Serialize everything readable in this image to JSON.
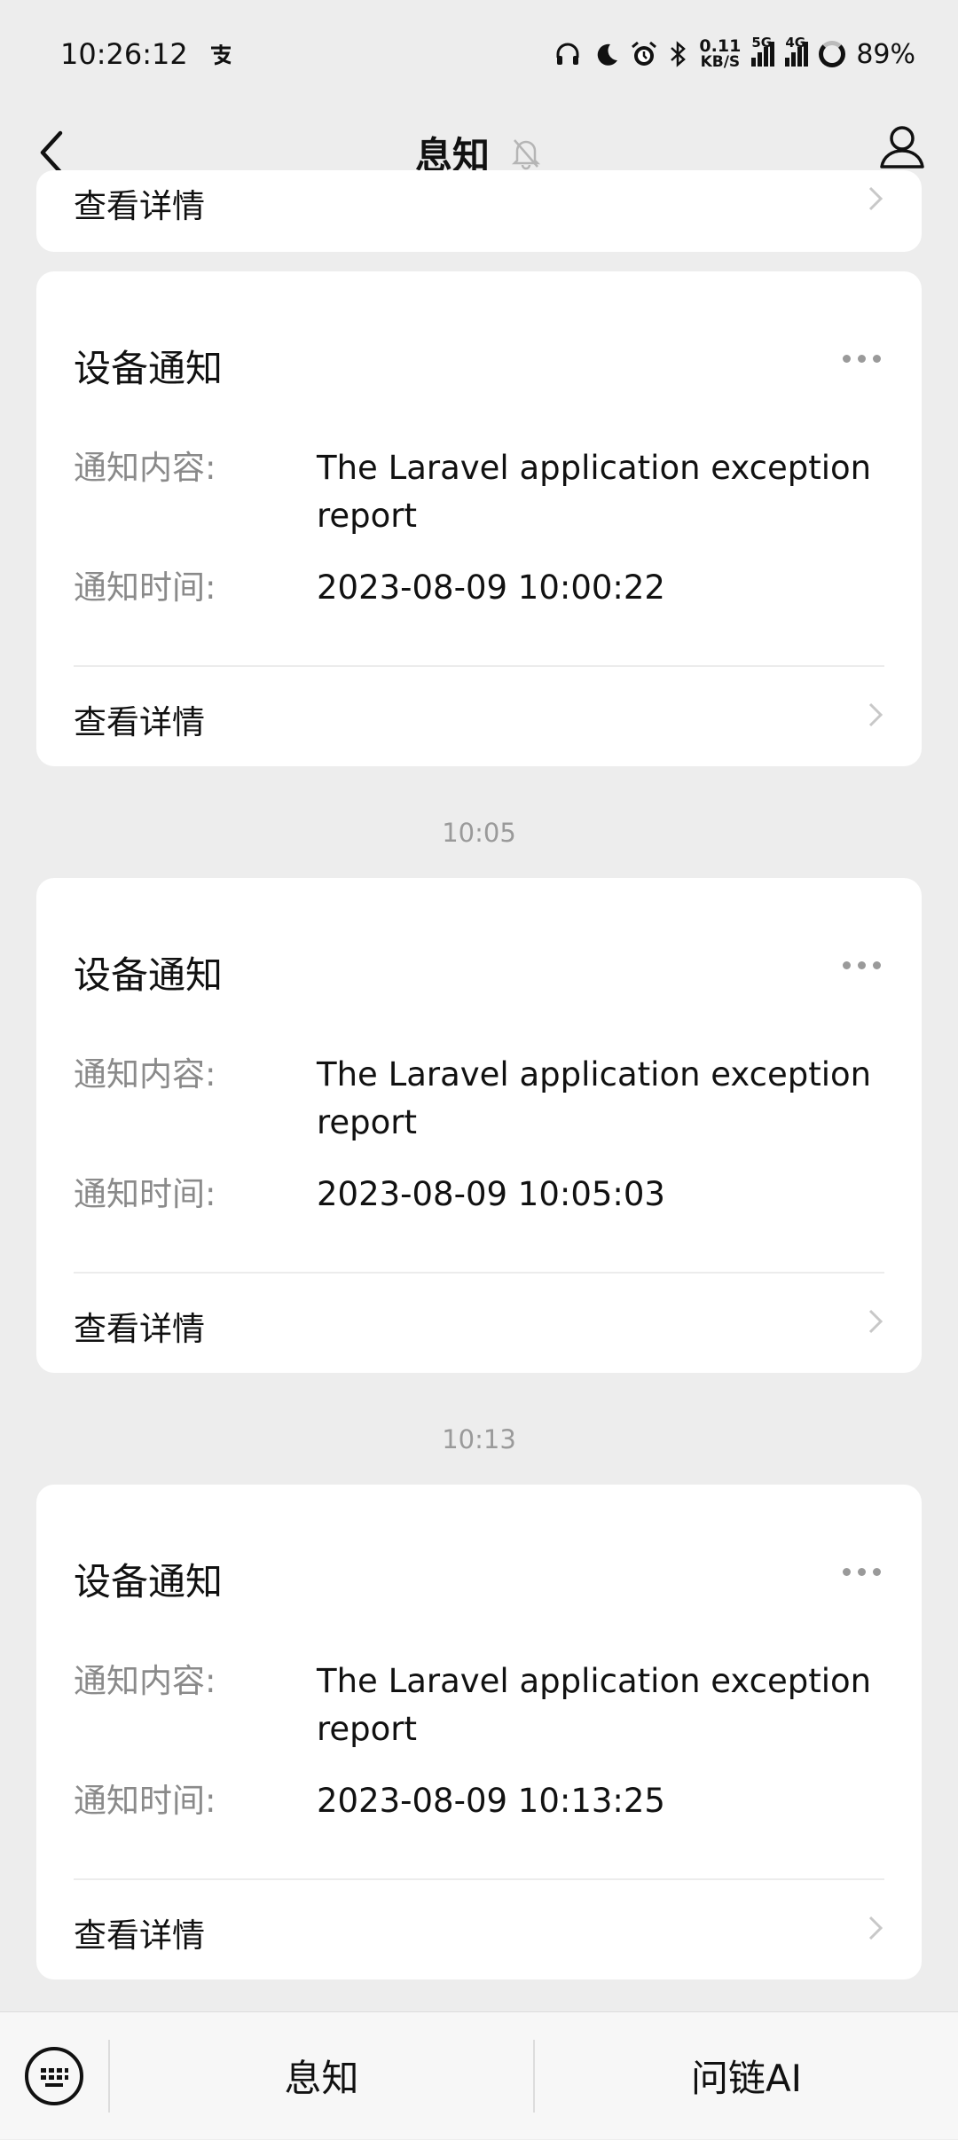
{
  "status_bar": {
    "time": "10:26:12",
    "app_icon": "alipay-icon",
    "net_speed_value": "0.11",
    "net_speed_unit": "KB/S",
    "signal1_label": "5G",
    "signal2_label": "4G",
    "battery": "89%"
  },
  "nav": {
    "title": "息知",
    "back_icon": "chevron-left-icon",
    "mute_icon": "bell-off-icon",
    "profile_icon": "user-icon"
  },
  "cards": [
    {
      "detail_label": "查看详情"
    },
    {
      "title": "设备通知",
      "content_key": "通知内容:",
      "content_value": "The Laravel application exception report",
      "time_key": "通知时间:",
      "time_value": "2023-08-09 10:00:22",
      "detail_label": "查看详情"
    },
    {
      "title": "设备通知",
      "content_key": "通知内容:",
      "content_value": "The Laravel application exception report",
      "time_key": "通知时间:",
      "time_value": "2023-08-09 10:05:03",
      "detail_label": "查看详情"
    },
    {
      "title": "设备通知",
      "content_key": "通知内容:",
      "content_value": "The Laravel application exception report",
      "time_key": "通知时间:",
      "time_value": "2023-08-09 10:13:25",
      "detail_label": "查看详情"
    }
  ],
  "time_separators": [
    "10:05",
    "10:13"
  ],
  "bottom_bar": {
    "keyboard_icon": "keyboard-icon",
    "menu1": "息知",
    "menu2": "问链AI"
  }
}
